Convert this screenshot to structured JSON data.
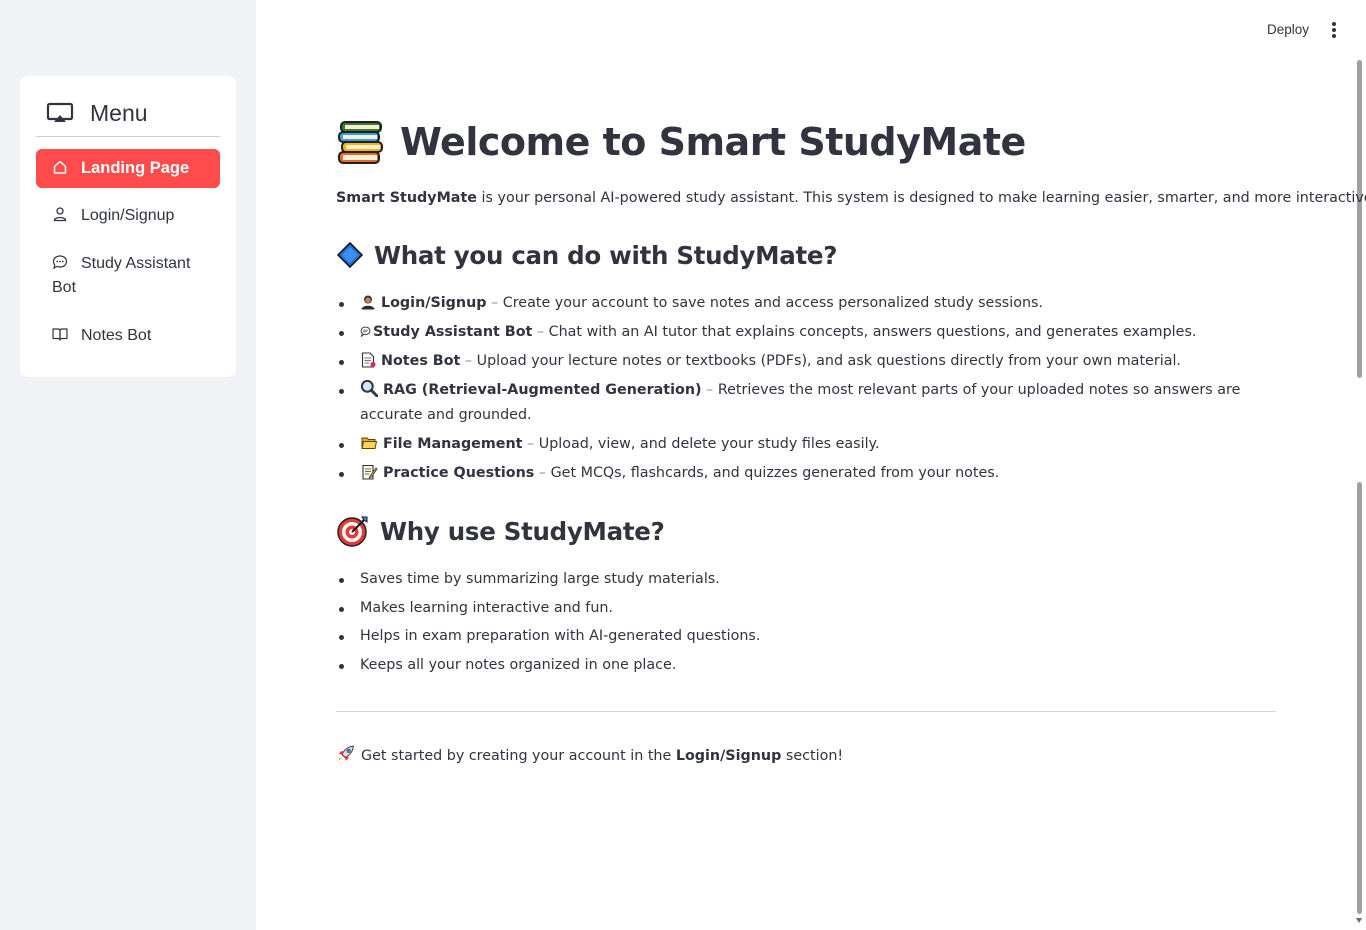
{
  "sidebar": {
    "menu_title": "Menu",
    "menu_icon": "monitor-icon",
    "items": [
      {
        "label": "Landing Page",
        "icon": "home-icon",
        "active": true
      },
      {
        "label": "Login/Signup",
        "icon": "user-icon",
        "active": false
      },
      {
        "label": "Study Assistant Bot",
        "icon": "chat-icon",
        "active": false
      },
      {
        "label": "Notes Bot",
        "icon": "book-icon",
        "active": false
      }
    ]
  },
  "header": {
    "deploy_label": "Deploy",
    "more_icon": "kebab-menu-icon"
  },
  "main": {
    "title": "Welcome to Smart StudyMate",
    "intro_bold": "Smart StudyMate",
    "intro_text": " is your personal AI-powered study assistant. This system is designed to make learning easier, smarter, and more interactive.",
    "features_heading": "What you can do with StudyMate?",
    "features": [
      {
        "icon": "person-icon",
        "name": "Login/Signup",
        "sep": " – ",
        "desc": "Create your account to save notes and access personalized study sessions."
      },
      {
        "icon": "chat-bubble-icon",
        "name": "Study Assistant Bot",
        "sep": " – ",
        "desc": "Chat with an AI tutor that explains concepts, answers questions, and generates examples."
      },
      {
        "icon": "document-icon",
        "name": "Notes Bot",
        "sep": " – ",
        "desc": "Upload your lecture notes or textbooks (PDFs), and ask questions directly from your own material."
      },
      {
        "icon": "magnifier-icon",
        "name": "RAG (Retrieval-Augmented Generation)",
        "sep": " – ",
        "desc": "Retrieves the most relevant parts of your uploaded notes so answers are accurate and grounded."
      },
      {
        "icon": "folder-icon",
        "name": "File Management",
        "sep": " – ",
        "desc": "Upload, view, and delete your study files easily."
      },
      {
        "icon": "memo-icon",
        "name": "Practice Questions",
        "sep": " – ",
        "desc": "Get MCQs, flashcards, and quizzes generated from your notes."
      }
    ],
    "why_heading": "Why use StudyMate?",
    "why_items": [
      "Saves time by summarizing large study materials.",
      "Makes learning interactive and fun.",
      "Helps in exam preparation with AI-generated questions.",
      "Keeps all your notes organized in one place."
    ],
    "footer_pre": "Get started by creating your account in the ",
    "footer_bold": "Login/Signup",
    "footer_post": " section!"
  },
  "colors": {
    "accent": "#ff4b4b",
    "sidebar_bg": "#f0f2f6",
    "text": "#31333f"
  }
}
